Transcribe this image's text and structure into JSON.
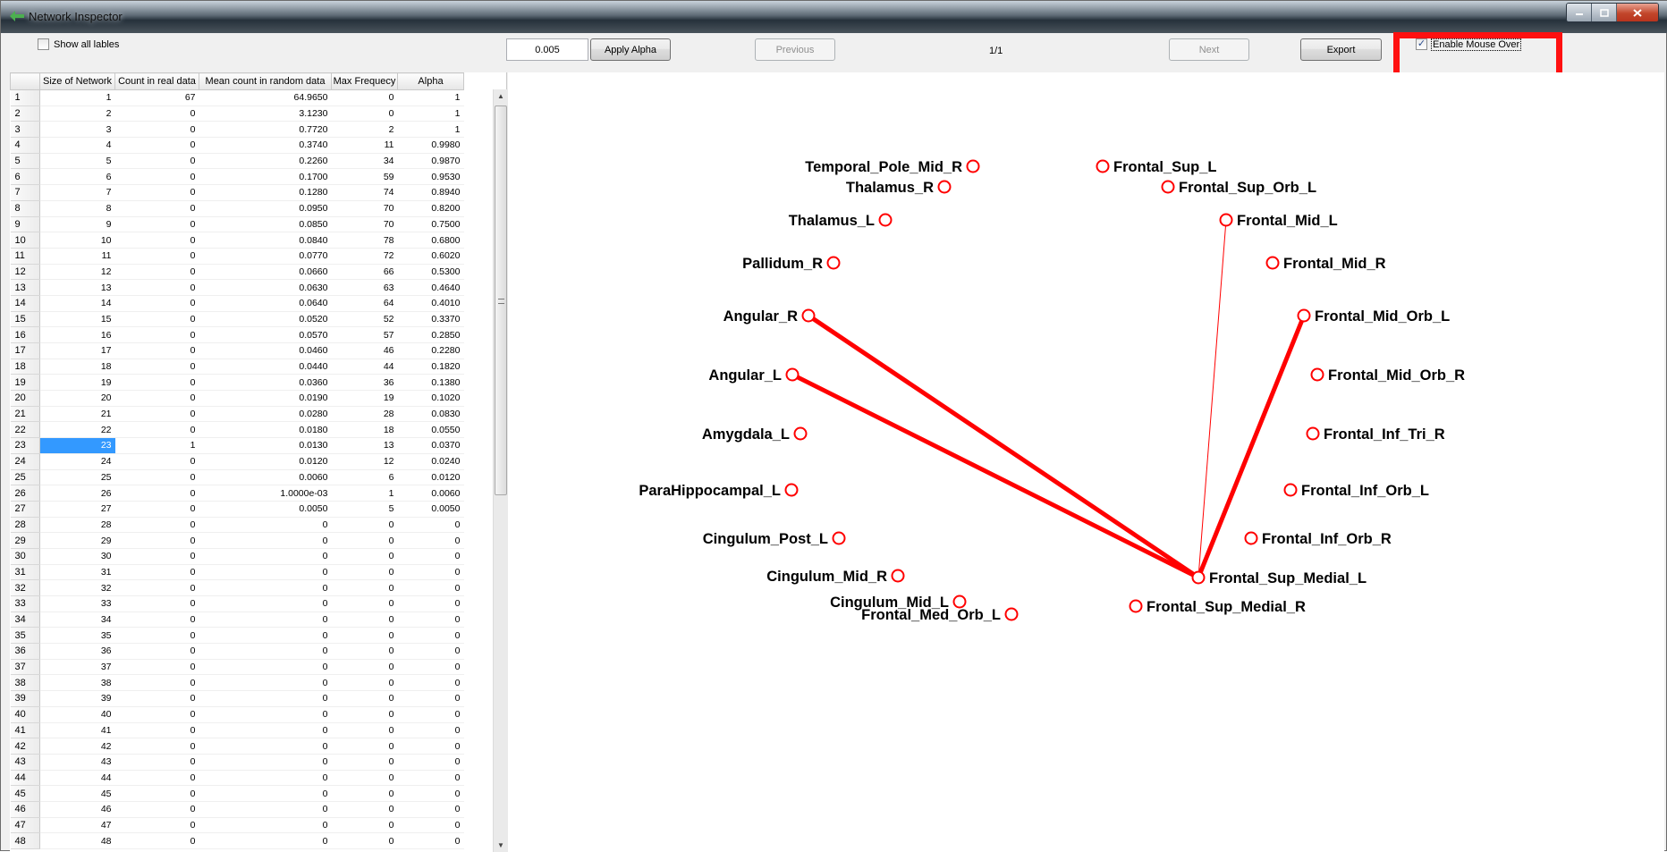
{
  "window": {
    "title": "Network Inspector"
  },
  "toolbar": {
    "show_all_labels": "Show all lables",
    "alpha_value": "0.005",
    "apply_alpha": "Apply Alpha",
    "previous": "Previous",
    "page_indicator": "1/1",
    "next": "Next",
    "export": "Export",
    "enable_mouse_over": "Enable Mouse Over"
  },
  "table": {
    "headers": [
      "Size of Network",
      "Count in real data",
      "Mean count in random data",
      "Max Frequecy",
      "Alpha"
    ],
    "rows": [
      [
        "1",
        "1",
        "67",
        "64.9650",
        "0",
        "1"
      ],
      [
        "2",
        "2",
        "0",
        "3.1230",
        "0",
        "1"
      ],
      [
        "3",
        "3",
        "0",
        "0.7720",
        "2",
        "1"
      ],
      [
        "4",
        "4",
        "0",
        "0.3740",
        "11",
        "0.9980"
      ],
      [
        "5",
        "5",
        "0",
        "0.2260",
        "34",
        "0.9870"
      ],
      [
        "6",
        "6",
        "0",
        "0.1700",
        "59",
        "0.9530"
      ],
      [
        "7",
        "7",
        "0",
        "0.1280",
        "74",
        "0.8940"
      ],
      [
        "8",
        "8",
        "0",
        "0.0950",
        "70",
        "0.8200"
      ],
      [
        "9",
        "9",
        "0",
        "0.0850",
        "70",
        "0.7500"
      ],
      [
        "10",
        "10",
        "0",
        "0.0840",
        "78",
        "0.6800"
      ],
      [
        "11",
        "11",
        "0",
        "0.0770",
        "72",
        "0.6020"
      ],
      [
        "12",
        "12",
        "0",
        "0.0660",
        "66",
        "0.5300"
      ],
      [
        "13",
        "13",
        "0",
        "0.0630",
        "63",
        "0.4640"
      ],
      [
        "14",
        "14",
        "0",
        "0.0640",
        "64",
        "0.4010"
      ],
      [
        "15",
        "15",
        "0",
        "0.0520",
        "52",
        "0.3370"
      ],
      [
        "16",
        "16",
        "0",
        "0.0570",
        "57",
        "0.2850"
      ],
      [
        "17",
        "17",
        "0",
        "0.0460",
        "46",
        "0.2280"
      ],
      [
        "18",
        "18",
        "0",
        "0.0440",
        "44",
        "0.1820"
      ],
      [
        "19",
        "19",
        "0",
        "0.0360",
        "36",
        "0.1380"
      ],
      [
        "20",
        "20",
        "0",
        "0.0190",
        "19",
        "0.1020"
      ],
      [
        "21",
        "21",
        "0",
        "0.0280",
        "28",
        "0.0830"
      ],
      [
        "22",
        "22",
        "0",
        "0.0180",
        "18",
        "0.0550"
      ],
      [
        "23",
        "23",
        "1",
        "0.0130",
        "13",
        "0.0370"
      ],
      [
        "24",
        "24",
        "0",
        "0.0120",
        "12",
        "0.0240"
      ],
      [
        "25",
        "25",
        "0",
        "0.0060",
        "6",
        "0.0120"
      ],
      [
        "26",
        "26",
        "0",
        "1.0000e-03",
        "1",
        "0.0060"
      ],
      [
        "27",
        "27",
        "0",
        "0.0050",
        "5",
        "0.0050"
      ],
      [
        "28",
        "28",
        "0",
        "0",
        "0",
        "0"
      ],
      [
        "29",
        "29",
        "0",
        "0",
        "0",
        "0"
      ],
      [
        "30",
        "30",
        "0",
        "0",
        "0",
        "0"
      ],
      [
        "31",
        "31",
        "0",
        "0",
        "0",
        "0"
      ],
      [
        "32",
        "32",
        "0",
        "0",
        "0",
        "0"
      ],
      [
        "33",
        "33",
        "0",
        "0",
        "0",
        "0"
      ],
      [
        "34",
        "34",
        "0",
        "0",
        "0",
        "0"
      ],
      [
        "35",
        "35",
        "0",
        "0",
        "0",
        "0"
      ],
      [
        "36",
        "36",
        "0",
        "0",
        "0",
        "0"
      ],
      [
        "37",
        "37",
        "0",
        "0",
        "0",
        "0"
      ],
      [
        "38",
        "38",
        "0",
        "0",
        "0",
        "0"
      ],
      [
        "39",
        "39",
        "0",
        "0",
        "0",
        "0"
      ],
      [
        "40",
        "40",
        "0",
        "0",
        "0",
        "0"
      ],
      [
        "41",
        "41",
        "0",
        "0",
        "0",
        "0"
      ],
      [
        "42",
        "42",
        "0",
        "0",
        "0",
        "0"
      ],
      [
        "43",
        "43",
        "0",
        "0",
        "0",
        "0"
      ],
      [
        "44",
        "44",
        "0",
        "0",
        "0",
        "0"
      ],
      [
        "45",
        "45",
        "0",
        "0",
        "0",
        "0"
      ],
      [
        "46",
        "46",
        "0",
        "0",
        "0",
        "0"
      ],
      [
        "47",
        "47",
        "0",
        "0",
        "0",
        "0"
      ],
      [
        "48",
        "48",
        "0",
        "0",
        "0",
        "0"
      ]
    ],
    "selected_row": 23
  },
  "network": {
    "node_color": "#ff0000",
    "edge_color": "#ff0000",
    "nodes": [
      {
        "id": "Temporal_Pole_Mid_R",
        "label": "Temporal_Pole_Mid_R"
      },
      {
        "id": "Thalamus_R",
        "label": "Thalamus_R"
      },
      {
        "id": "Thalamus_L",
        "label": "Thalamus_L"
      },
      {
        "id": "Pallidum_R",
        "label": "Pallidum_R"
      },
      {
        "id": "Angular_R",
        "label": "Angular_R"
      },
      {
        "id": "Angular_L",
        "label": "Angular_L"
      },
      {
        "id": "Amygdala_L",
        "label": "Amygdala_L"
      },
      {
        "id": "ParaHippocampal_L",
        "label": "ParaHippocampal_L"
      },
      {
        "id": "Cingulum_Post_L",
        "label": "Cingulum_Post_L"
      },
      {
        "id": "Cingulum_Mid_R",
        "label": "Cingulum_Mid_R"
      },
      {
        "id": "Cingulum_Mid_L",
        "label": "Cingulum_Mid_L"
      },
      {
        "id": "Frontal_Med_Orb_L",
        "label": "Frontal_Med_Orb_L"
      },
      {
        "id": "Frontal_Sup_L",
        "label": "Frontal_Sup_L"
      },
      {
        "id": "Frontal_Sup_Orb_L",
        "label": "Frontal_Sup_Orb_L"
      },
      {
        "id": "Frontal_Mid_L",
        "label": "Frontal_Mid_L"
      },
      {
        "id": "Frontal_Mid_R",
        "label": "Frontal_Mid_R"
      },
      {
        "id": "Frontal_Mid_Orb_L",
        "label": "Frontal_Mid_Orb_L"
      },
      {
        "id": "Frontal_Mid_Orb_R",
        "label": "Frontal_Mid_Orb_R"
      },
      {
        "id": "Frontal_Inf_Tri_R",
        "label": "Frontal_Inf_Tri_R"
      },
      {
        "id": "Frontal_Inf_Orb_L",
        "label": "Frontal_Inf_Orb_L"
      },
      {
        "id": "Frontal_Inf_Orb_R",
        "label": "Frontal_Inf_Orb_R"
      },
      {
        "id": "Frontal_Sup_Medial_L",
        "label": "Frontal_Sup_Medial_L"
      },
      {
        "id": "Frontal_Sup_Medial_R",
        "label": "Frontal_Sup_Medial_R"
      }
    ],
    "edges": [
      {
        "source": "Frontal_Sup_Medial_L",
        "target": "Angular_R",
        "weight": "thick"
      },
      {
        "source": "Frontal_Sup_Medial_L",
        "target": "Angular_L",
        "weight": "thick"
      },
      {
        "source": "Frontal_Sup_Medial_L",
        "target": "Frontal_Mid_Orb_L",
        "weight": "thick"
      },
      {
        "source": "Frontal_Sup_Medial_L",
        "target": "Frontal_Mid_L",
        "weight": "thin"
      }
    ]
  }
}
